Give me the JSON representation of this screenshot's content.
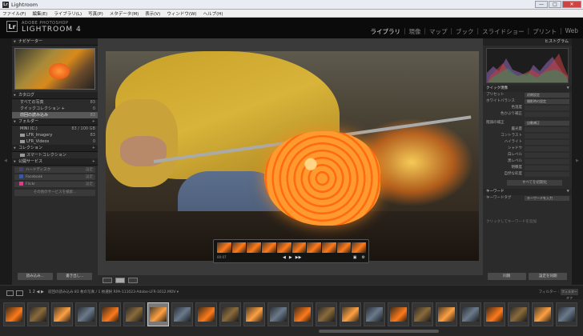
{
  "window": {
    "title": "Lightroom",
    "app_icon": "Lr",
    "buttons": [
      "—",
      "□",
      "✕"
    ]
  },
  "menu": [
    "ファイル(F)",
    "編集(E)",
    "ライブラリ(L)",
    "写真(P)",
    "メタデータ(M)",
    "表示(V)",
    "ウィンドウ(W)",
    "ヘルプ(H)"
  ],
  "brand": {
    "logo": "Lr",
    "top": "ADOBE PHOTOSHOP",
    "name": "LIGHTROOM 4"
  },
  "modules": [
    {
      "label": "ライブラリ",
      "active": true
    },
    {
      "label": "現像",
      "active": false
    },
    {
      "label": "マップ",
      "active": false
    },
    {
      "label": "ブック",
      "active": false
    },
    {
      "label": "スライドショー",
      "active": false
    },
    {
      "label": "プリント",
      "active": false
    },
    {
      "label": "Web",
      "active": false
    }
  ],
  "left": {
    "navigator": "ナビゲーター",
    "catalog": {
      "title": "カタログ",
      "items": [
        {
          "label": "すべての写真",
          "count": "83"
        },
        {
          "label": "クイックコレクション +",
          "count": "0"
        },
        {
          "label": "前回の読み込み",
          "count": "83"
        }
      ]
    },
    "folders": {
      "title": "フォルダー",
      "volume": {
        "label": "MINI (C:)",
        "count": "83 / 100 GB"
      },
      "items": [
        {
          "label": "LFR_Imagery",
          "count": "83"
        },
        {
          "label": "LFR_Videos",
          "count": "0"
        }
      ]
    },
    "collections": "コレクション",
    "smart_collections": "スマートコレクション",
    "publish": {
      "title": "公開サービス",
      "items": [
        {
          "label": "ハードディスク",
          "action": "設定"
        },
        {
          "label": "Facebook",
          "action": "設定"
        },
        {
          "label": "Flickr",
          "action": "設定"
        }
      ],
      "more": "その他のサービスを検索..."
    },
    "import_btn": "読み込み...",
    "export_btn": "書き出し..."
  },
  "video": {
    "time": "00:07",
    "controls": [
      "◀",
      "▶",
      "▶▶"
    ],
    "right": [
      "▣",
      "⚙"
    ]
  },
  "right": {
    "histogram": "ヒストグラム",
    "quick_develop": "クイック現像",
    "rows": [
      {
        "label": "プリセット",
        "value": "初期設定"
      },
      {
        "label": "ホワイトバランス",
        "value": "撮影時の設定"
      }
    ],
    "wb_sub": [
      "色温度",
      "色かぶり補正"
    ],
    "tone_label": "階調の補正",
    "tone_value": "自動補正",
    "tone_sub": [
      "露光量",
      "コントラスト",
      "ハイライト",
      "シャドウ",
      "白レベル",
      "黒レベル",
      "明瞭度",
      "自然な彩度"
    ],
    "reset_btn": "すべてを初期化",
    "keywords": "キーワード",
    "keyword_tag": "キーワードタグ",
    "keyword_value": "キーワードを入力",
    "keyword_hint": "クリックしてキーワードを追加",
    "sync_btn": "同期",
    "sync_settings_btn": "設定を同期"
  },
  "filmstrip": {
    "nav": "1  2  ◀ ▶",
    "info": "前回の読み込み  83 枚の写真 / 1 枚選択  RPA-111023-Adobe-LFR-1612.MOV ▾",
    "filter_label": "フィルター :",
    "filter_value": "フィルターオフ",
    "thumbs": 24,
    "selected": 6
  },
  "colors": {
    "accent_ui": "#2b2b2b",
    "flame": "#ff7a1a",
    "shirt": "#d0a830"
  }
}
